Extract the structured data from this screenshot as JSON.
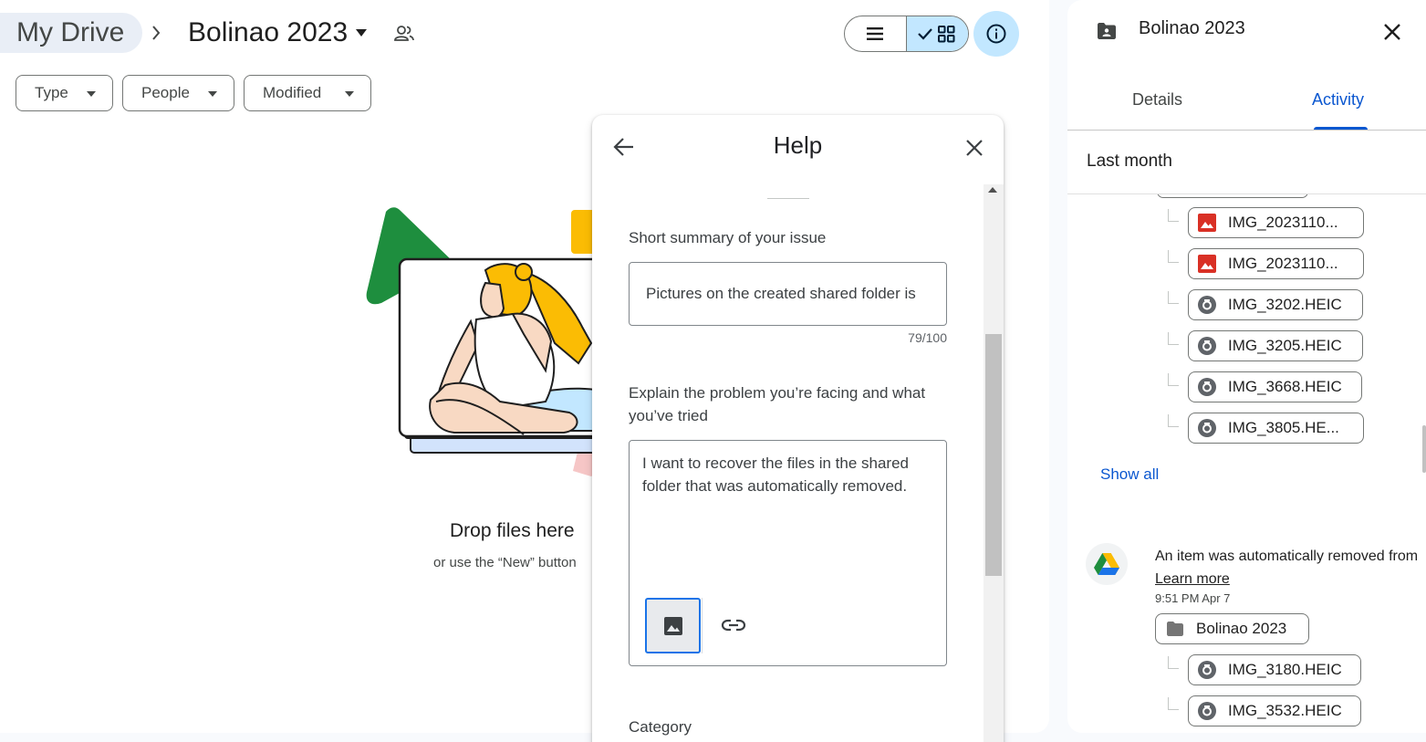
{
  "breadcrumb": {
    "root": "My Drive",
    "current": "Bolinao 2023"
  },
  "filters": {
    "type": "Type",
    "people": "People",
    "modified": "Modified"
  },
  "empty_state": {
    "title": "Drop files here",
    "subtitle": "or use the “New” button"
  },
  "help": {
    "title": "Help",
    "summary_label": "Short summary of your issue",
    "summary_value": "Pictures on the created shared folder is",
    "counter": "79/100",
    "explain_label": "Explain the problem you’re facing and what you’ve tried",
    "explain_value": "I want to recover the files in the shared folder that was automatically removed.",
    "category_label": "Category"
  },
  "details_panel": {
    "title": "Bolinao 2023",
    "tabs": [
      {
        "label": "Details",
        "active": false
      },
      {
        "label": "Activity",
        "active": true
      }
    ],
    "section": "Last month",
    "files_group_1": [
      {
        "name": "IMG_2023110...",
        "icon": "image-icon"
      },
      {
        "name": "IMG_2023110...",
        "icon": "image-icon"
      },
      {
        "name": "IMG_3202.HEIC",
        "icon": "camera-icon"
      },
      {
        "name": "IMG_3205.HEIC",
        "icon": "camera-icon"
      },
      {
        "name": "IMG_3668.HEIC",
        "icon": "camera-icon"
      },
      {
        "name": "IMG_3805.HE...",
        "icon": "camera-icon"
      }
    ],
    "show_all": "Show all",
    "activity": {
      "text": "An item was automatically removed from",
      "link": "Learn more",
      "time": "9:51 PM Apr 7",
      "folder": "Bolinao 2023",
      "files": [
        {
          "name": "IMG_3180.HEIC",
          "icon": "camera-icon"
        },
        {
          "name": "IMG_3532.HEIC",
          "icon": "camera-icon"
        }
      ]
    }
  },
  "colors": {
    "accent": "#0b57d0",
    "selected_bg": "#c2e7ff",
    "image_icon": "#d93025",
    "heic_icon": "#5f6368"
  }
}
